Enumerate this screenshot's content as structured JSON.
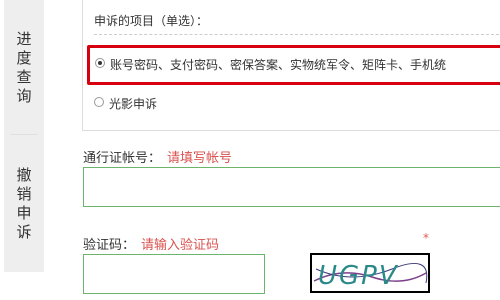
{
  "sidebar": {
    "items": [
      {
        "label": "进度查询",
        "chars": [
          "进",
          "度",
          "查",
          "询"
        ]
      },
      {
        "label": "撤销申诉",
        "chars": [
          "撤",
          "销",
          "申",
          "诉"
        ]
      }
    ]
  },
  "appeal_items": {
    "label": "申诉的项目（单选）：",
    "options": [
      {
        "text": "账号密码、支付密码、密保答案、实物统军令、矩阵卡、手机统",
        "selected": true
      },
      {
        "text": "光影申诉",
        "selected": false
      }
    ]
  },
  "account": {
    "label": "通行证帐号：",
    "hint": "请填写帐号",
    "value": ""
  },
  "verification": {
    "label": "验证码：",
    "hint": "请输入验证码",
    "value": "",
    "required_mark": "*",
    "captcha_text": "UGPV"
  },
  "colors": {
    "highlight_border": "#d7000f",
    "hint_text": "#d9534f",
    "input_border": "#6db56d",
    "sidebar_bg": "#eeeeee",
    "captcha_text": "#2a8a8a"
  }
}
